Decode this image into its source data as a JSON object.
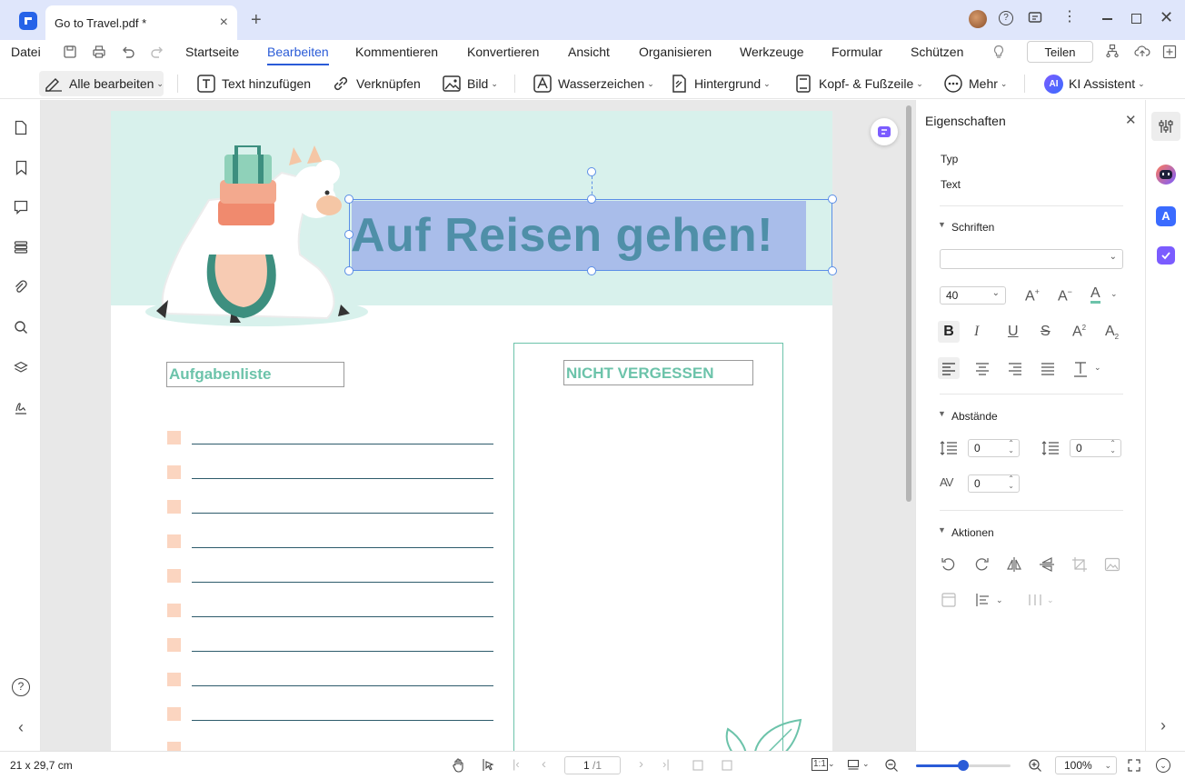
{
  "tab": {
    "title": "Go to Travel.pdf *"
  },
  "menu": {
    "datei": "Datei",
    "items": [
      "Startseite",
      "Bearbeiten",
      "Kommentieren",
      "Konvertieren",
      "Ansicht",
      "Organisieren",
      "Werkzeuge",
      "Formular",
      "Schützen"
    ],
    "active": "Bearbeiten",
    "share": "Teilen"
  },
  "toolbar": {
    "edit_all": "Alle bearbeiten",
    "add_text": "Text hinzufügen",
    "link": "Verknüpfen",
    "image": "Bild",
    "watermark": "Wasserzeichen",
    "background": "Hintergrund",
    "header_footer": "Kopf- & Fußzeile",
    "more": "Mehr",
    "ai_badge": "AI",
    "ai": "KI Assistent"
  },
  "document": {
    "title": "Auf Reisen gehen!",
    "todo_title": "Aufgabenliste",
    "remember_title": "NICHT VERGESSEN",
    "colors": {
      "band": "#d8f1ec",
      "title_text": "#4f8fa8",
      "selection": "#a9bdea",
      "teal": "#6cc3aa",
      "checkbox": "#fbd5c0",
      "line": "#2d5b6b"
    }
  },
  "properties": {
    "title": "Eigenschaften",
    "type_label": "Typ",
    "type_value": "Text",
    "fonts_section": "Schriften",
    "font_size": "40",
    "spacing_section": "Abstände",
    "line_spacing": "0",
    "paragraph_spacing": "0",
    "char_spacing": "0",
    "actions_section": "Aktionen"
  },
  "status": {
    "page_size": "21 x 29,7 cm",
    "page_current": "1",
    "page_total": "/1",
    "zoom": "100%",
    "zoom_level": 0.5
  }
}
